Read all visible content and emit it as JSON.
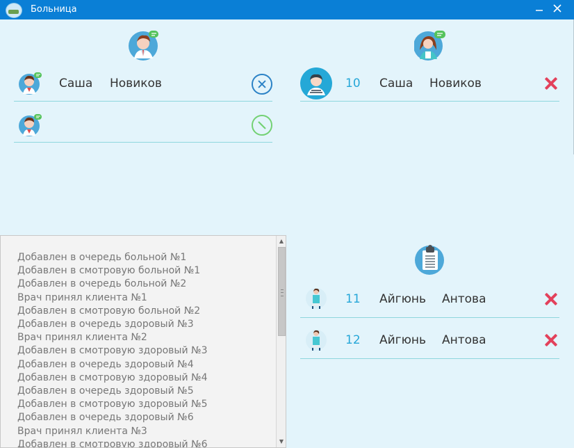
{
  "window": {
    "title": "Больница",
    "minimize_icon": "minimize-icon",
    "close_icon": "close-icon"
  },
  "doctor_panel": {
    "header_icon": "doctor-icon",
    "current": {
      "first_name": "Саша",
      "last_name": "Новиков"
    },
    "action_icon": "circle-close-icon",
    "empty_slot_icon": "circle-close-icon-green"
  },
  "reception_panel": {
    "header_icon": "nurse-icon",
    "rows": [
      {
        "number": "10",
        "first_name": "Саша",
        "last_name": "Новиков",
        "avatar_icon": "patient-avatar-icon",
        "delete_icon": "red-close-icon"
      }
    ]
  },
  "queue_panel": {
    "header_icon": "clipboard-icon",
    "rows": [
      {
        "number": "11",
        "first_name": "Айгюнь",
        "last_name": "Антова",
        "avatar_icon": "woman-avatar-icon",
        "delete_icon": "red-close-icon"
      },
      {
        "number": "12",
        "first_name": "Айгюнь",
        "last_name": "Антова",
        "avatar_icon": "woman-avatar-icon",
        "delete_icon": "red-close-icon"
      }
    ]
  },
  "log": {
    "entries": [
      "Добавлен в очередь больной  №1",
      "Добавлен в смотровую больной  №1",
      "Добавлен в очередь больной  №2",
      "Врач принял клиента №1",
      "Добавлен в смотровую больной  №2",
      "Добавлен в очередь здоровый  №3",
      "Врач принял клиента №2",
      "Добавлен в смотровую здоровый  №3",
      "Добавлен в очередь здоровый  №4",
      "Добавлен в смотровую здоровый  №4",
      "Добавлен в очередь здоровый  №5",
      "Добавлен в смотровую здоровый  №5",
      "Добавлен в очередь здоровый  №6",
      "Врач принял клиента №3",
      "Добавлен в смотровую здоровый  №6"
    ]
  }
}
